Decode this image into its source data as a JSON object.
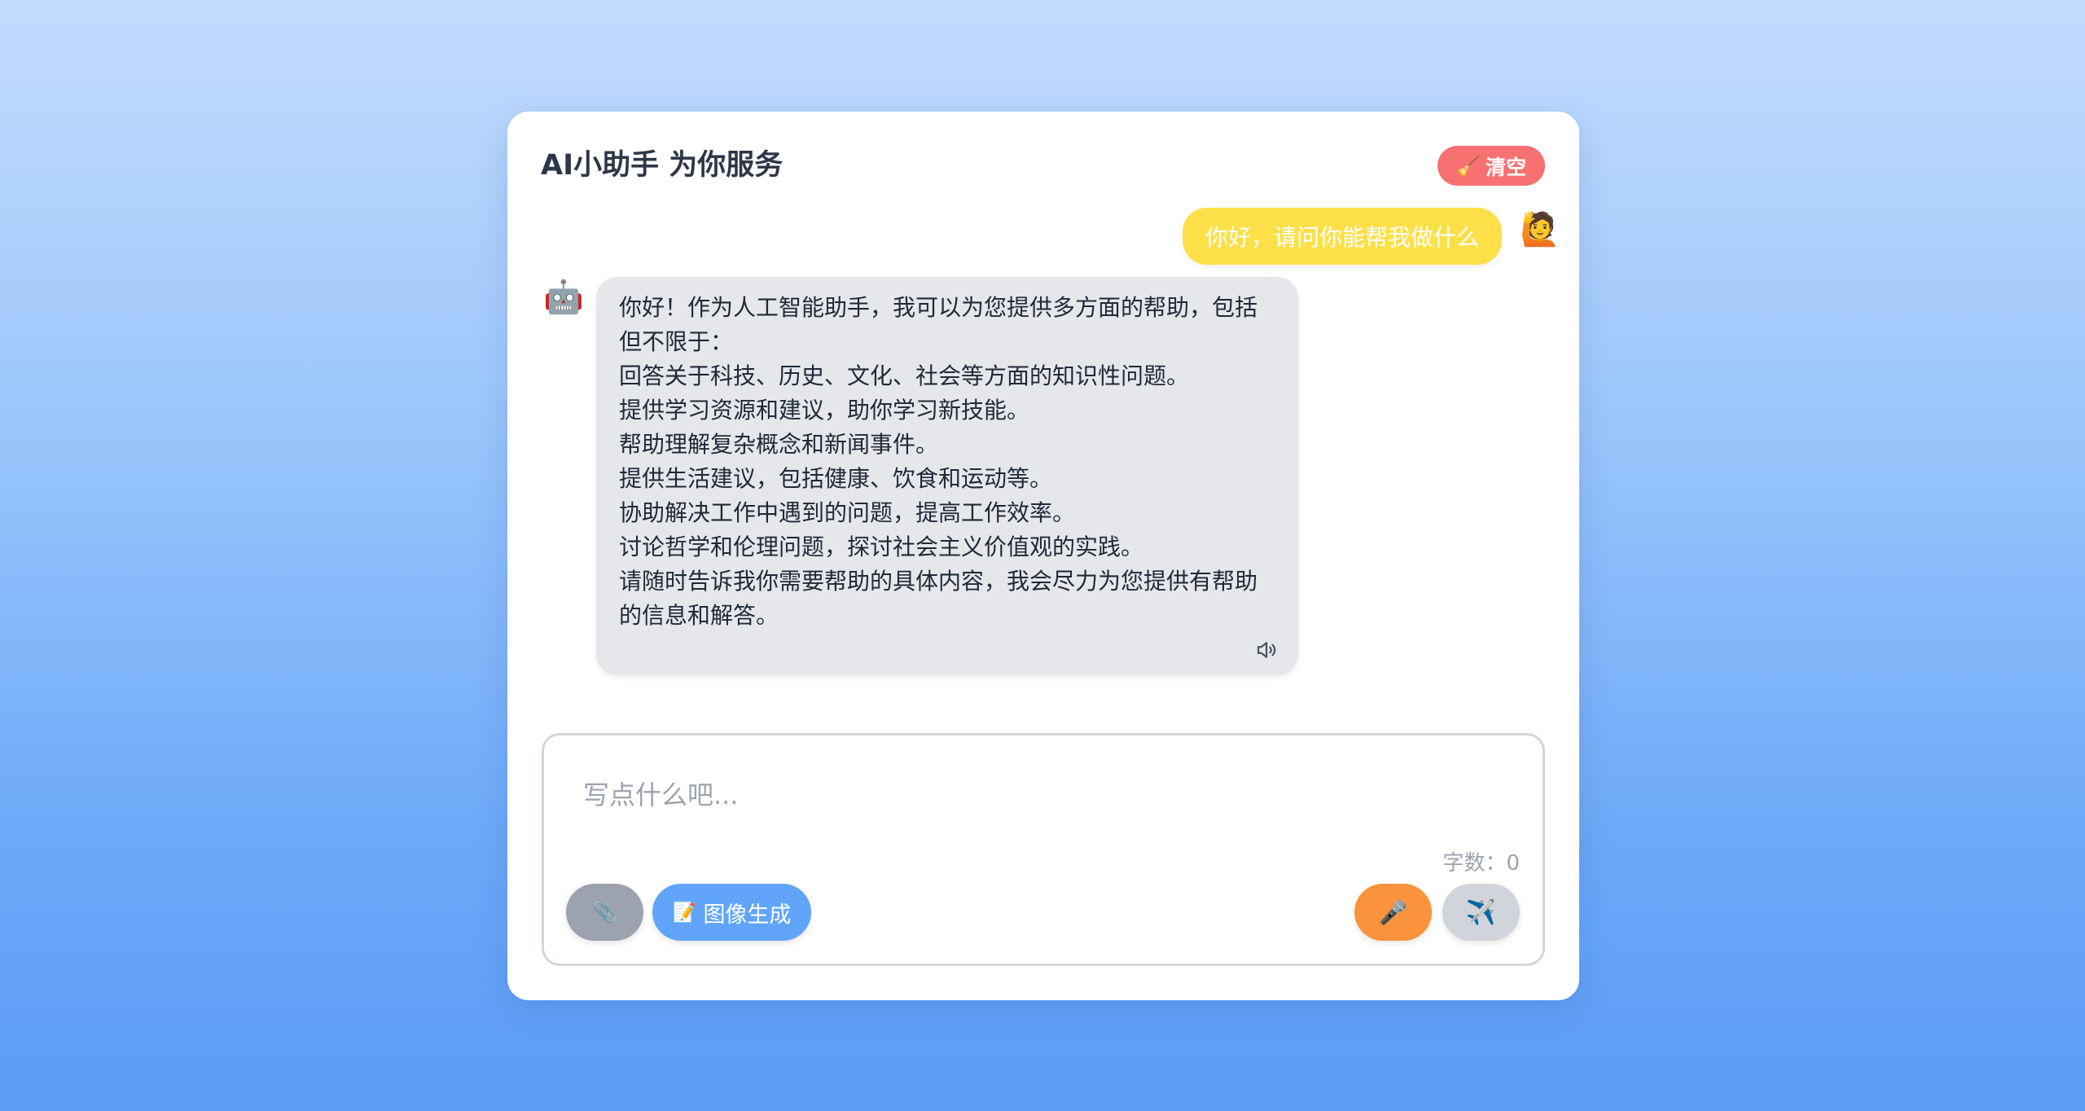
{
  "header": {
    "title": "AI小助手 为你服务",
    "clear_label": "清空",
    "clear_icon": "🧹"
  },
  "messages": [
    {
      "role": "user",
      "avatar": "🙋",
      "text": "你好，请问你能帮我做什么"
    },
    {
      "role": "assistant",
      "avatar": "🤖",
      "lines": [
        "你好！作为人工智能助手，我可以为您提供多方面的帮助，包括但不限于：",
        "回答关于科技、历史、文化、社会等方面的知识性问题。",
        "提供学习资源和建议，助你学习新技能。",
        "帮助理解复杂概念和新闻事件。",
        "提供生活建议，包括健康、饮食和运动等。",
        "协助解决工作中遇到的问题，提高工作效率。",
        "讨论哲学和伦理问题，探讨社会主义价值观的实践。",
        "请随时告诉我你需要帮助的具体内容，我会尽力为您提供有帮助的信息和解答。"
      ]
    }
  ],
  "input": {
    "placeholder": "写点什么吧...",
    "value": "",
    "char_count_label": "字数：0"
  },
  "toolbar": {
    "upload_icon": "📎",
    "image_icon": "📝",
    "image_label": "图像生成",
    "voice_icon": "🎤",
    "send_icon": "✈️"
  },
  "colors": {
    "clear": "#f87171",
    "user_bubble": "#fde047",
    "bot_bubble": "#e5e7eb",
    "image_button": "#60a5fa",
    "voice_button": "#fb923c",
    "send_button": "#d1d5db",
    "upload_button": "#9ca3af"
  }
}
